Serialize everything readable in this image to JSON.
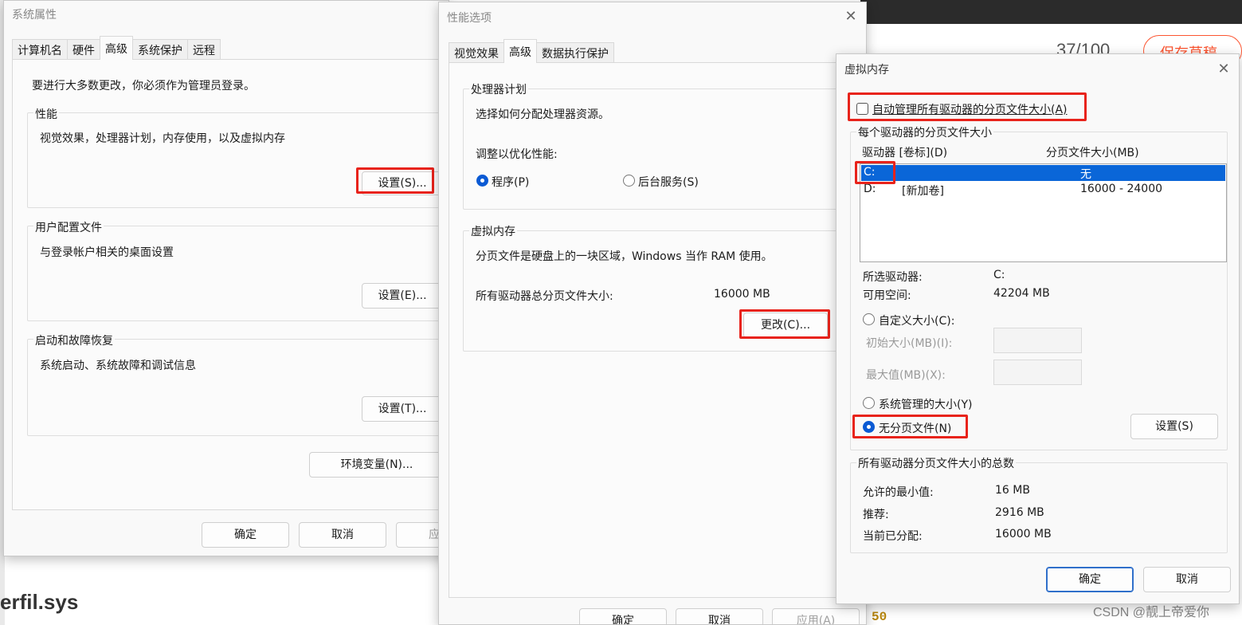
{
  "background": {
    "counter": "37/100",
    "save_draft": "保存草稿",
    "filename": "erfil.sys",
    "line_number": "50",
    "watermark": "CSDN @靓上帝爱你"
  },
  "system_properties": {
    "title": "系统属性",
    "tabs": [
      "计算机名",
      "硬件",
      "高级",
      "系统保护",
      "远程"
    ],
    "active_tab": "高级",
    "admin_note": "要进行大多数更改，你必须作为管理员登录。",
    "performance": {
      "title": "性能",
      "desc": "视觉效果，处理器计划，内存使用，以及虚拟内存",
      "button": "设置(S)..."
    },
    "user_profiles": {
      "title": "用户配置文件",
      "desc": "与登录帐户相关的桌面设置",
      "button": "设置(E)..."
    },
    "startup_recovery": {
      "title": "启动和故障恢复",
      "desc": "系统启动、系统故障和调试信息",
      "button": "设置(T)..."
    },
    "env_button": "环境变量(N)...",
    "ok": "确定",
    "cancel": "取消",
    "apply": "应用"
  },
  "performance_options": {
    "title": "性能选项",
    "tabs": [
      "视觉效果",
      "高级",
      "数据执行保护"
    ],
    "active_tab": "高级",
    "processor": {
      "title": "处理器计划",
      "desc": "选择如何分配处理器资源。",
      "adjust_label": "调整以优化性能:",
      "opt_programs": "程序(P)",
      "opt_background": "后台服务(S)",
      "selected": "程序(P)"
    },
    "virtual_memory": {
      "title": "虚拟内存",
      "desc": "分页文件是硬盘上的一块区域，Windows 当作 RAM 使用。",
      "total_label": "所有驱动器总分页文件大小:",
      "total_value": "16000 MB",
      "change_button": "更改(C)..."
    },
    "ok": "确定",
    "cancel": "取消",
    "apply": "应用(A)"
  },
  "virtual_memory": {
    "title": "虚拟内存",
    "auto_manage": "自动管理所有驱动器的分页文件大小(A)",
    "auto_manage_checked": false,
    "per_drive_title": "每个驱动器的分页文件大小",
    "col_drive": "驱动器 [卷标](D)",
    "col_size": "分页文件大小(MB)",
    "drives": [
      {
        "drive": "C:",
        "label": "",
        "size": "无",
        "selected": true
      },
      {
        "drive": "D:",
        "label": "[新加卷]",
        "size": "16000 - 24000",
        "selected": false
      }
    ],
    "selected_drive_label": "所选驱动器:",
    "selected_drive_value": "C:",
    "free_space_label": "可用空间:",
    "free_space_value": "42204 MB",
    "custom_size": "自定义大小(C):",
    "initial_size": "初始大小(MB)(I):",
    "max_size": "最大值(MB)(X):",
    "system_managed": "系统管理的大小(Y)",
    "no_paging": "无分页文件(N)",
    "selected_option": "无分页文件(N)",
    "set_button": "设置(S)",
    "totals_title": "所有驱动器分页文件大小的总数",
    "min_allowed_label": "允许的最小值:",
    "min_allowed_value": "16 MB",
    "recommended_label": "推荐:",
    "recommended_value": "2916 MB",
    "current_label": "当前已分配:",
    "current_value": "16000 MB",
    "ok": "确定",
    "cancel": "取消"
  },
  "colors": {
    "highlight": "#e8231b",
    "selection": "#0a66d8",
    "accent": "#2f6fca"
  }
}
